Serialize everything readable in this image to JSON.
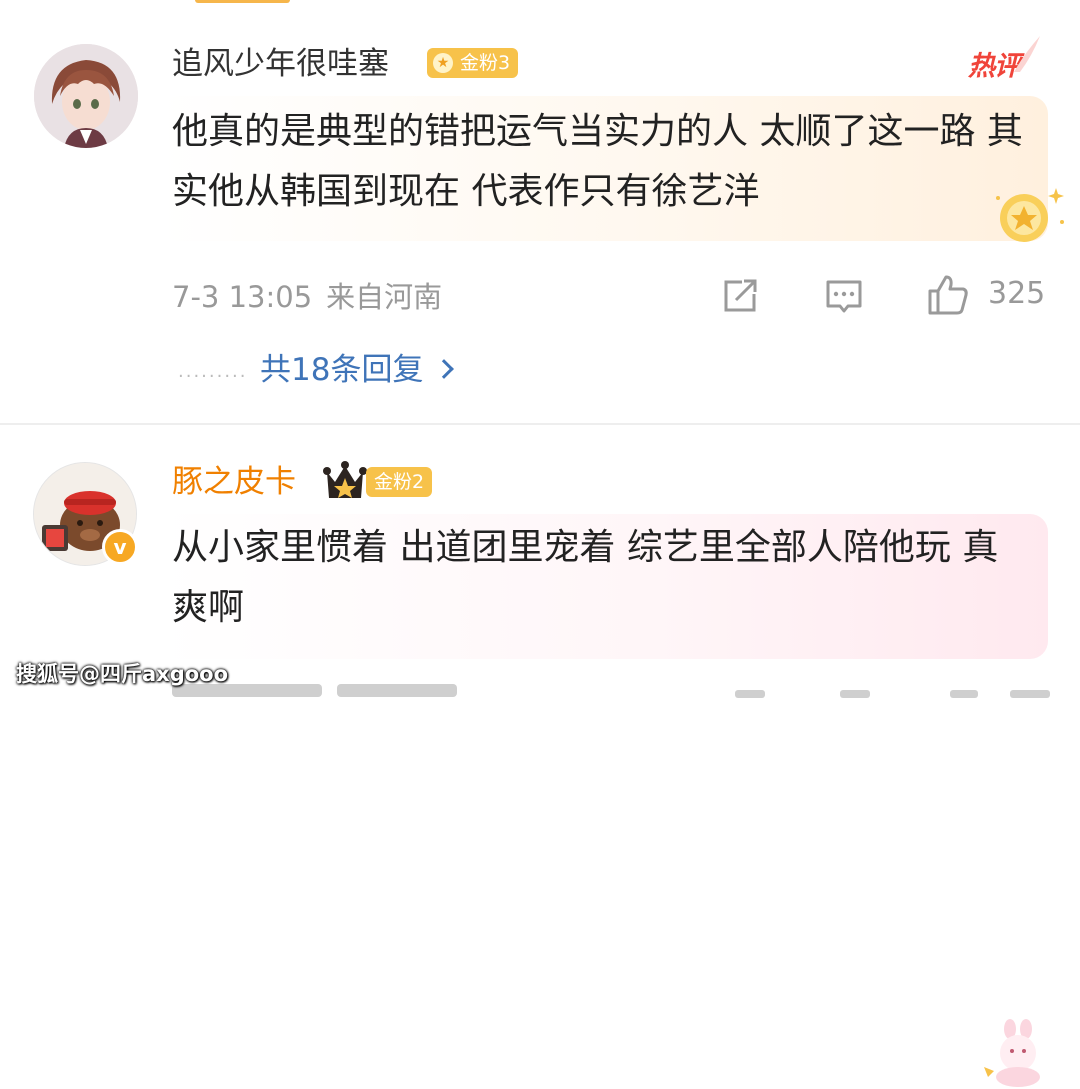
{
  "comments": [
    {
      "username": "追风少年很哇塞",
      "fan_badge": "金粉3",
      "hot_label": "热评",
      "content": "他真的是典型的错把运气当实力的人 太顺了这一路 其实他从韩国到现在 代表作只有徐艺洋",
      "time": "7-3 13:05",
      "location": "来自河南",
      "like_count": "325",
      "replies_label": "共18条回复",
      "dots": "·········"
    },
    {
      "username": "豚之皮卡",
      "fan_badge": "金粉2",
      "verified_mark": "v",
      "content": "从小家里惯着 出道团里宠着 综艺里全部人陪他玩 真爽啊"
    }
  ],
  "watermark": "搜狐号@四斤axgooo",
  "colors": {
    "accent_orange": "#f08000",
    "fan_badge": "#f7c24a",
    "hot_red": "#f0443a",
    "link_blue": "#3f74b8"
  },
  "icons": [
    "share-icon",
    "comment-icon",
    "like-icon",
    "chevron-right-icon",
    "crown-icon",
    "star-badge-icon"
  ]
}
